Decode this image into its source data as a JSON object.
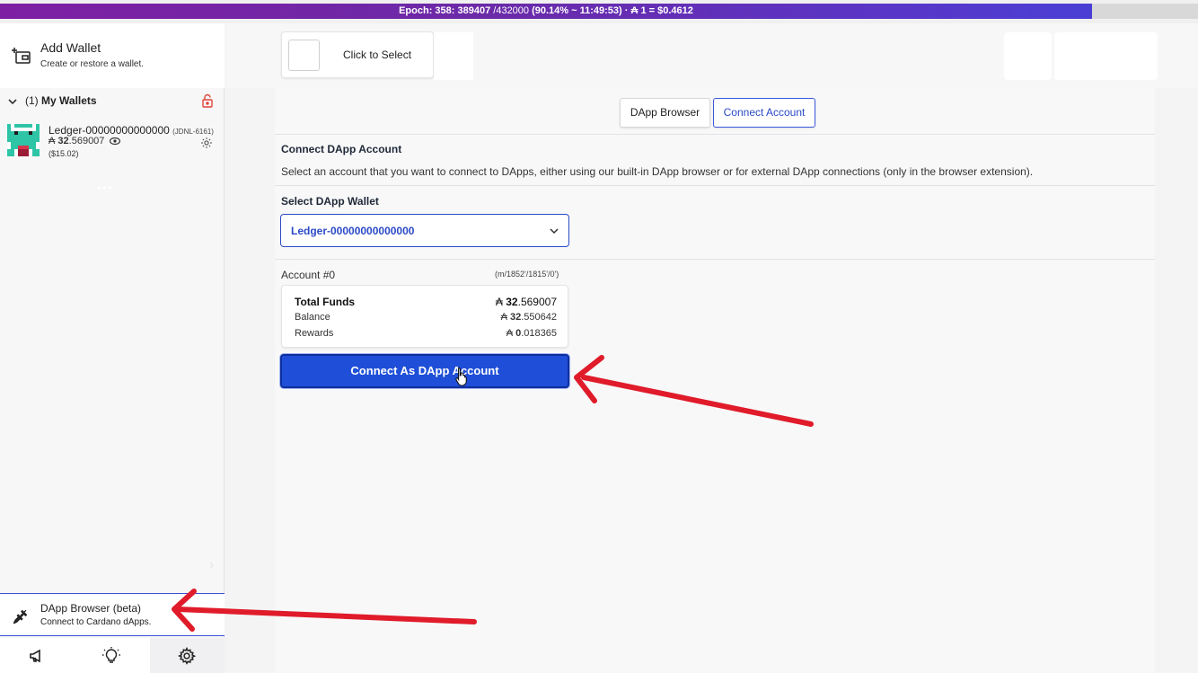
{
  "epoch_bar": {
    "epoch_label": "Epoch: 358: 389407",
    "slot_total": " /432000",
    "progress": " (90.14% ~ 11:49:53)",
    "price": " · ₳ 1 = $0.4612"
  },
  "sidebar": {
    "add_wallet": {
      "title": "Add Wallet",
      "subtitle": "Create or restore a wallet."
    },
    "my_wallets": {
      "count": "(1)",
      "label": "My Wallets"
    },
    "wallet": {
      "name": "Ledger-00000000000000",
      "tag": "(JDNL-6161)",
      "balance_symbol": "₳",
      "balance_whole": "32",
      "balance_decimal": ".569007",
      "fiat": "($15.02)"
    },
    "dapp_browser": {
      "title": "DApp Browser (beta)",
      "subtitle": "Connect to Cardano dApps."
    },
    "bottom_icons": [
      "megaphone-icon",
      "lightbulb-icon",
      "gear-icon"
    ]
  },
  "topbar": {
    "select_label": "Click to Select"
  },
  "tabs": [
    {
      "label": "DApp Browser",
      "active": false
    },
    {
      "label": "Connect Account",
      "active": true
    }
  ],
  "connect": {
    "title": "Connect DApp Account",
    "description": "Select an account that you want to connect to DApps, either using our built-in DApp browser or for external DApp connections (only in the browser extension).",
    "wallet_label": "Select DApp Wallet",
    "selected_wallet": "Ledger-00000000000000",
    "account_label": "Account #0",
    "account_path": "(m/1852'/1815'/0')",
    "funds": [
      {
        "label": "Total Funds",
        "symbol": "₳",
        "whole": "32",
        "decimal": ".569007"
      },
      {
        "label": "Balance",
        "symbol": "₳",
        "whole": "32",
        "decimal": ".550642"
      },
      {
        "label": "Rewards",
        "symbol": "₳",
        "whole": "0",
        "decimal": ".018365"
      }
    ],
    "button_label": "Connect As DApp Account"
  },
  "colors": {
    "accent": "#1f4fd8",
    "epoch_bar": "#7e1fa3",
    "annotation_arrow": "#e01b2a"
  }
}
